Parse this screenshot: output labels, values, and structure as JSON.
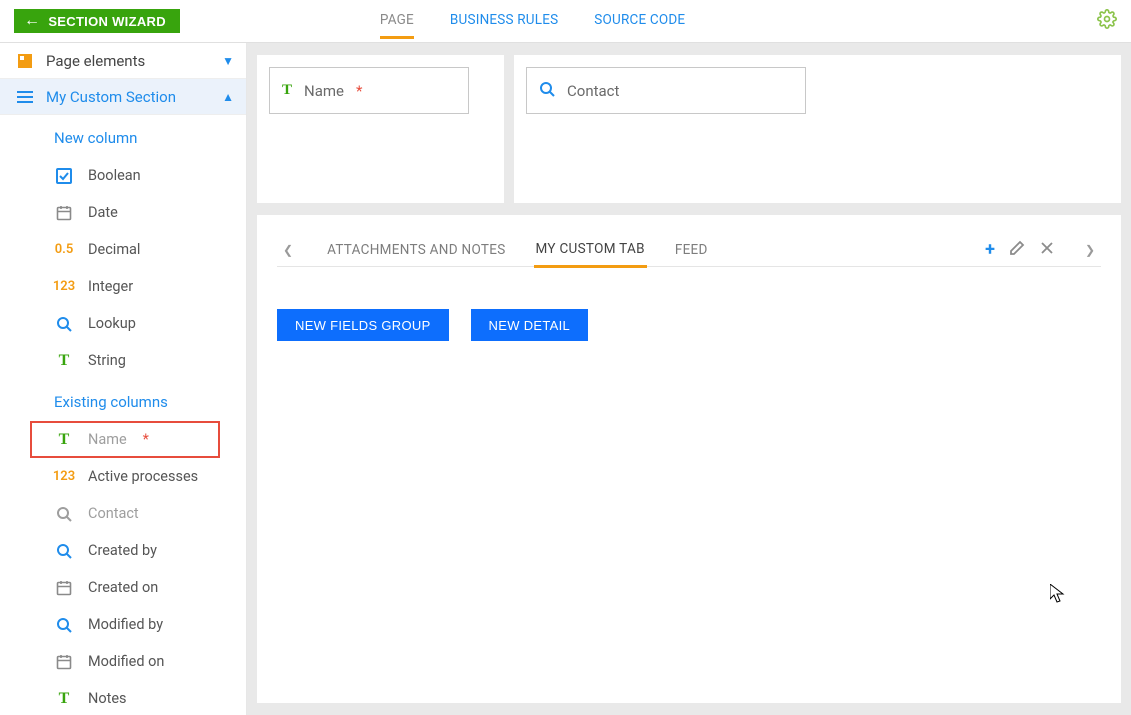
{
  "header": {
    "section_wizard": "SECTION WIZARD",
    "tabs": [
      {
        "label": "PAGE",
        "active": true
      },
      {
        "label": "BUSINESS RULES",
        "active": false
      },
      {
        "label": "SOURCE CODE",
        "active": false
      }
    ]
  },
  "sidebar": {
    "page_elements": "Page elements",
    "my_custom_section": "My Custom Section",
    "new_column_heading": "New column",
    "existing_columns_heading": "Existing columns",
    "new_columns": [
      {
        "icon": "check",
        "label": "Boolean"
      },
      {
        "icon": "calendar",
        "label": "Date"
      },
      {
        "icon": "decimal",
        "label": "Decimal"
      },
      {
        "icon": "integer",
        "label": "Integer"
      },
      {
        "icon": "lookup",
        "label": "Lookup"
      },
      {
        "icon": "string",
        "label": "String"
      }
    ],
    "existing_columns": [
      {
        "icon": "string",
        "label": "Name",
        "required": true,
        "muted": true,
        "highlight": true
      },
      {
        "icon": "integer",
        "label": "Active processes"
      },
      {
        "icon": "lookup",
        "label": "Contact",
        "muted": true
      },
      {
        "icon": "lookup",
        "label": "Created by"
      },
      {
        "icon": "calendar",
        "label": "Created on"
      },
      {
        "icon": "lookup",
        "label": "Modified by"
      },
      {
        "icon": "calendar",
        "label": "Modified on"
      },
      {
        "icon": "string",
        "label": "Notes"
      }
    ]
  },
  "canvas": {
    "fields": {
      "name": {
        "label": "Name",
        "required": true,
        "icon": "string"
      },
      "contact": {
        "label": "Contact",
        "icon": "lookup"
      }
    },
    "tab_strip": [
      {
        "label": "ATTACHMENTS AND NOTES",
        "active": false
      },
      {
        "label": "MY CUSTOM TAB",
        "active": true
      },
      {
        "label": "FEED",
        "active": false
      }
    ],
    "buttons": {
      "new_fields_group": "NEW FIELDS GROUP",
      "new_detail": "NEW DETAIL"
    }
  },
  "icons": {
    "check": "check",
    "calendar": "calendar",
    "decimal": "0.5",
    "integer": "123",
    "lookup": "lookup",
    "string": "T"
  },
  "colors": {
    "accent_green": "#38a40d",
    "accent_orange": "#f39c12",
    "link_blue": "#1f8ceb",
    "button_blue": "#0d6efd",
    "highlight_red": "#e74c3c"
  }
}
